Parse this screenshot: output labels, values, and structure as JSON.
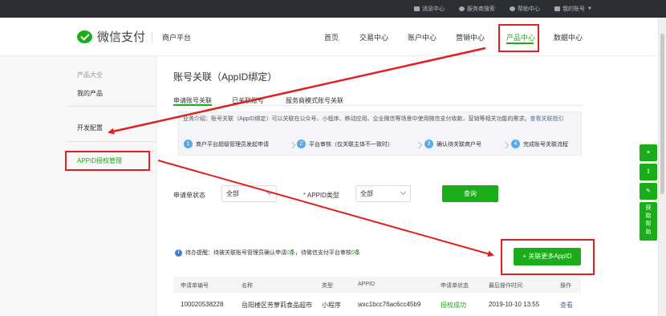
{
  "topbar": {
    "links": [
      {
        "icon": "message-icon",
        "label": "消息中心"
      },
      {
        "icon": "service-icon",
        "label": "服务商搜索"
      },
      {
        "icon": "help-icon",
        "label": "帮助中心"
      },
      {
        "icon": "user-icon",
        "label": "我的账号"
      }
    ]
  },
  "header": {
    "brand": "微信支付",
    "platform": "商户平台",
    "nav": [
      "首页",
      "交易中心",
      "账户中心",
      "营销中心",
      "产品中心",
      "数据中心"
    ],
    "active_nav": "产品中心"
  },
  "sidebar": {
    "section_label": "产品大全",
    "my_products": "我的产品",
    "dev_config": "开发配置",
    "appid_mgmt": "APPID授权管理"
  },
  "main": {
    "title": "账号关联（AppID绑定）",
    "tabs": [
      "申请账号关联",
      "已关联账号",
      "服务商模式账号关联"
    ],
    "info": {
      "text": "业务介绍：账号关联（AppID绑定）可以关联在公众号、小程序、移动应用、企业微信等场景中使用微信支付收款，营销等相关功能的需求。",
      "link": "查看关联指引",
      "steps": [
        {
          "num": "1",
          "label": "商户平台超级管理员发起申请"
        },
        {
          "num": "2",
          "label": "平台审核（仅关联主体不一致时）"
        },
        {
          "num": "3",
          "label": "确认待关联商户号"
        },
        {
          "num": "4",
          "label": "完成账号关联流程"
        }
      ]
    },
    "filters": {
      "status_label": "申请单状态",
      "status_value": "全部",
      "type_label": "APPID类型",
      "type_value": "全部",
      "query_button": "查询"
    },
    "notice": {
      "prefix": "待办提醒：待被关联账号管理员确认申请",
      "count1": "0",
      "middle": "条，待微信支付平台审核",
      "count2": "0",
      "suffix": "条"
    },
    "add_button": "关联更多AppID",
    "table": {
      "headers": [
        "申请单编号",
        "名称",
        "类型",
        "APPID",
        "申请单状态",
        "最后操作时间",
        "操作"
      ],
      "rows": [
        {
          "id": "100020538228",
          "name": "岳阳楼区芳萝莉食品超市",
          "type": "小程序",
          "appid": "wxc1bcc76ac6cc45b9",
          "status": "授权成功",
          "time": "2019-10-10 13:55",
          "action": "查看"
        }
      ]
    }
  },
  "float_tools": {
    "icons": [
      "link-icon",
      "download-icon",
      "edit-icon"
    ],
    "help_chars": [
      "获",
      "取",
      "帮",
      "助"
    ]
  },
  "colors": {
    "brand_green": "#1aad19",
    "annotation_red": "#e02020",
    "topbar_bg": "#2b2e33"
  }
}
